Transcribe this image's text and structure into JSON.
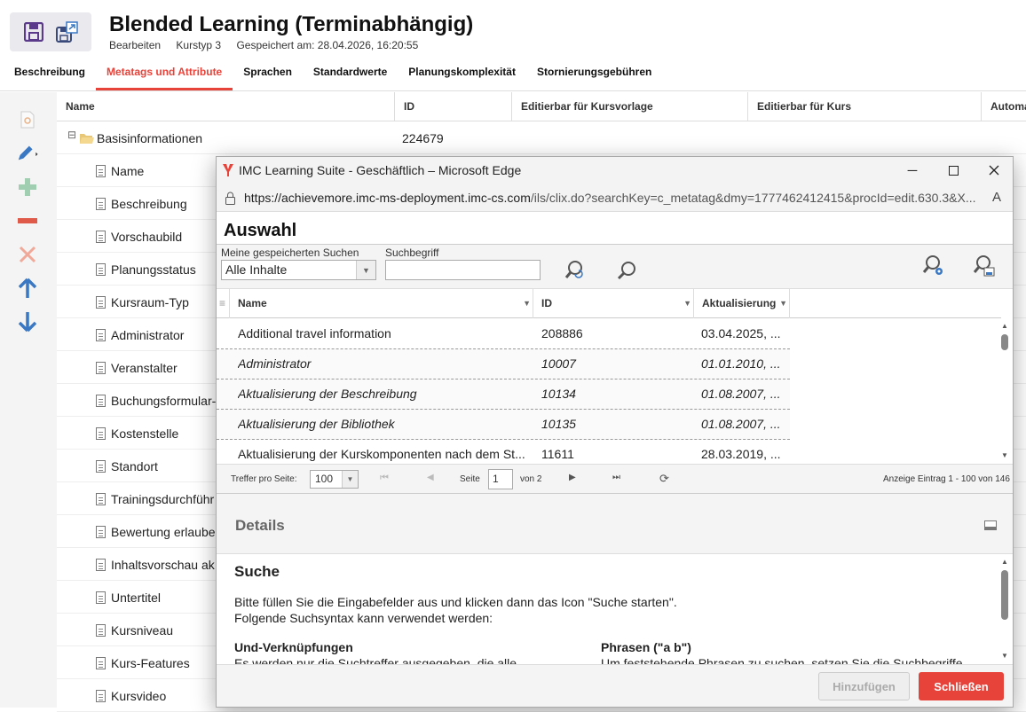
{
  "header": {
    "title": "Blended Learning (Terminabhängig)",
    "sub": [
      "Bearbeiten",
      "Kurstyp 3",
      "Gespeichert am: 28.04.2026, 16:20:55"
    ]
  },
  "tabs": [
    "Beschreibung",
    "Metatags und Attribute",
    "Sprachen",
    "Standardwerte",
    "Planungskomplexität",
    "Stornierungsgebühren"
  ],
  "grid": {
    "columns": [
      "Name",
      "ID",
      "Editierbar für Kursvorlage",
      "Editierbar für Kurs",
      "Automa"
    ],
    "root": {
      "name": "Basisinformationen",
      "id": "224679",
      "expander": "⊟"
    },
    "items": [
      "Name",
      "Beschreibung",
      "Vorschaubild",
      "Planungsstatus",
      "Kursraum-Typ",
      "Administrator",
      "Veranstalter",
      "Buchungsformular-",
      "Kostenstelle",
      "Standort",
      "Trainingsdurchführ",
      "Bewertung erlaube",
      "Inhaltsvorschau ak",
      "Untertitel",
      "Kursniveau",
      "Kurs-Features",
      "Kursvideo"
    ]
  },
  "modal": {
    "window_title": "IMC Learning Suite - Geschäftlich – Microsoft Edge",
    "url_prefix": "https://achievemore.imc-ms-deployment.imc-cs.com",
    "url_rest": "/ils/clix.do?searchKey=c_metatag&dmy=1777462412415&procId=edit.630.3&X...",
    "read_aloud": "A",
    "heading": "Auswahl",
    "saved_search_label": "Meine gespeicherten Suchen",
    "saved_search_value": "Alle Inhalte",
    "search_term_label": "Suchbegriff",
    "columns": [
      "Name",
      "ID",
      "Aktualisierung"
    ],
    "rows": [
      {
        "name": "Additional travel information",
        "id": "208886",
        "updated": "03.04.2025, ..."
      },
      {
        "name": "Administrator",
        "id": "10007",
        "updated": "01.01.2010, ..."
      },
      {
        "name": "Aktualisierung der Beschreibung",
        "id": "10134",
        "updated": "01.08.2007, ..."
      },
      {
        "name": "Aktualisierung der Bibliothek",
        "id": "10135",
        "updated": "01.08.2007, ..."
      },
      {
        "name": "Aktualisierung der Kurskomponenten nach dem St...",
        "id": "11611",
        "updated": "28.03.2019, ..."
      }
    ],
    "pager": {
      "per_page_label": "Treffer pro Seite:",
      "per_page_value": "100",
      "page_label": "Seite",
      "page_value": "1",
      "of_label": "von 2",
      "summary": "Anzeige Eintrag 1 - 100 von 146"
    },
    "details_title": "Details",
    "details": {
      "heading": "Suche",
      "p1": "Bitte füllen Sie die Eingabefelder aus und klicken dann das Icon \"Suche starten\".",
      "p2": "Folgende Suchsyntax kann verwendet werden:",
      "h_left": "Und-Verknüpfungen",
      "t_left": "Es werden nur die Suchtreffer ausgegeben, die alle",
      "h_right": "Phrasen (\"a b\")",
      "t_right": "Um feststehende Phrasen zu suchen, setzen Sie die Suchbegriffe"
    },
    "add_button": "Hinzufügen",
    "close_button": "Schließen"
  },
  "colors": {
    "accent": "#e8433a",
    "blue": "#3a78c3",
    "save_purple": "#5b3a8c"
  }
}
